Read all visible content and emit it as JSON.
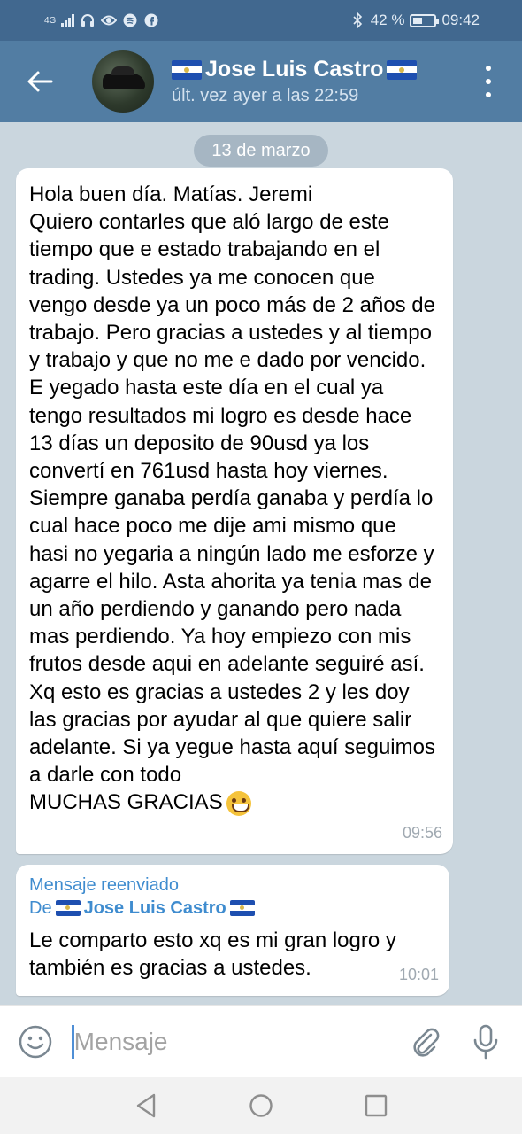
{
  "status_bar": {
    "network": "4G",
    "battery": "42 %",
    "time": "09:42"
  },
  "header": {
    "contact_name": "Jose Luis Castro",
    "last_seen": "últ. vez ayer a las 22:59"
  },
  "chat": {
    "date_separator": "13 de marzo",
    "messages": [
      {
        "text": "Hola buen día. Matías. Jeremi\nQuiero contarles que aló largo de este tiempo que e estado trabajando en el trading. Ustedes ya me conocen que vengo desde ya un poco más de 2 años de trabajo. Pero gracias a ustedes y al tiempo y trabajo y que no me e dado por vencido. E yegado hasta este día en el cual ya tengo resultados mi logro es desde hace 13 días un deposito de 90usd ya los convertí en 761usd hasta hoy viernes. Siempre ganaba perdía ganaba y perdía lo cual hace poco me dije ami mismo que hasi no yegaria a ningún lado me esforze y agarre el hilo. Asta ahorita ya tenia mas de un año perdiendo y ganando pero nada mas perdiendo. Ya hoy empiezo con mis frutos desde aqui en adelante seguiré así. Xq esto es gracias a ustedes 2 y les doy las gracias por ayudar al que quiere salir adelante. Si ya yegue hasta aquí seguimos a darle con todo\nMUCHAS GRACIAS",
        "time": "09:56"
      },
      {
        "forwarded_label": "Mensaje reenviado",
        "forwarded_from_prefix": "De",
        "forwarded_from_name": "Jose Luis Castro",
        "text": "Le comparto esto xq es mi gran logro y también es gracias a ustedes.",
        "time": "10:01"
      }
    ]
  },
  "composer": {
    "placeholder": "Mensaje"
  },
  "icons": [
    "back-arrow-icon",
    "more-vert-icon",
    "emoji-icon",
    "attach-icon",
    "mic-icon",
    "nav-back-icon",
    "nav-home-icon",
    "nav-recents-icon"
  ],
  "colors": {
    "header": "#527da3",
    "status_bar": "#41688f",
    "link_blue": "#3f8ccf",
    "chat_bg": "#cad6de"
  }
}
